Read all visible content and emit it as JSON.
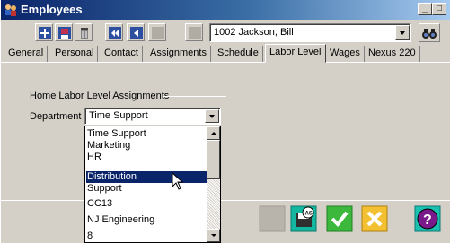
{
  "window": {
    "title": "Employees",
    "min_label": "_",
    "max_label": "□"
  },
  "toolbar": {
    "employee_selected": "1002 Jackson, Bill",
    "icons": [
      "new-icon",
      "save-disk-icon",
      "trash-icon",
      "first-record-icon",
      "previous-record-icon",
      "next-record-icon",
      "last-record-icon",
      "binoculars-icon"
    ]
  },
  "tabs": [
    {
      "label": "General"
    },
    {
      "label": "Personal"
    },
    {
      "label": "Contact"
    },
    {
      "label": "Assignments"
    },
    {
      "label": "Schedule"
    },
    {
      "label": "Labor Level",
      "active": true
    },
    {
      "label": "Wages"
    },
    {
      "label": "Nexus 220"
    }
  ],
  "labor": {
    "group_title": "Home Labor Level Assignments",
    "department_label": "Department",
    "department_value": "Time Support",
    "options": [
      "Time Support",
      "Marketing",
      "HR",
      "Distribution",
      "Support",
      "CC13",
      "NJ Engineering",
      "8"
    ],
    "highlighted": "Distribution"
  },
  "bottom_buttons": [
    "disabled-button",
    "save-as-icon",
    "checkmark-icon",
    "cancel-x-icon",
    "help-icon"
  ],
  "colors": {
    "selection": "#0a246a",
    "titlebar": "#0a246a",
    "face": "#d4d0c8"
  }
}
